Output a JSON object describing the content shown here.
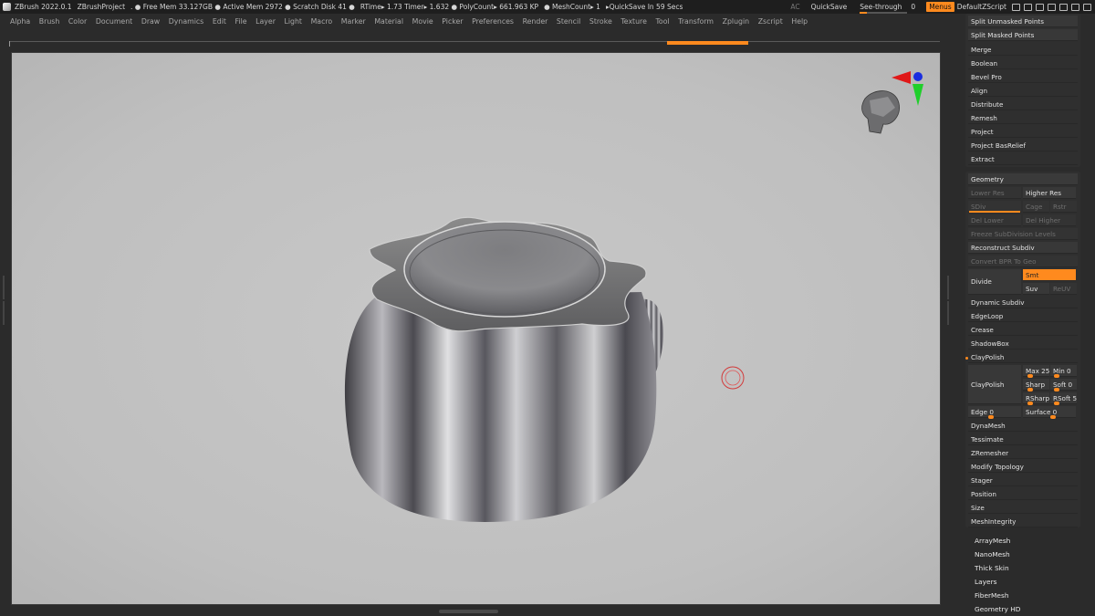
{
  "titlebar": {
    "items": [
      "ZBrush 2022.0.1",
      "ZBrushProject",
      ". ● Free Mem 33.127GB ● Active Mem 2972 ● Scratch Disk 41 ●",
      "RTime▸ 1.73 Timer▸ 1.632 ● PolyCount▸ 661.963 KP",
      "● MeshCount▸ 1",
      "▸QuickSave In 59 Secs"
    ],
    "ac": "AC",
    "quicksave": "QuickSave",
    "see_through_label": "See-through",
    "see_through_value": "0",
    "menus": "Menus",
    "default_zscript": "DefaultZScript"
  },
  "menubar": [
    "Alpha",
    "Brush",
    "Color",
    "Document",
    "Draw",
    "Dynamics",
    "Edit",
    "File",
    "Layer",
    "Light",
    "Macro",
    "Marker",
    "Material",
    "Movie",
    "Picker",
    "Preferences",
    "Render",
    "Stencil",
    "Stroke",
    "Texture",
    "Tool",
    "Transform",
    "Zplugin",
    "Zscript",
    "Help"
  ],
  "top_list": [
    "Split Unmasked Points",
    "Split Masked Points",
    "Merge",
    "Boolean",
    "Bevel Pro",
    "Align",
    "Distribute",
    "Remesh",
    "Project",
    "Project BasRelief",
    "Extract"
  ],
  "geometry": {
    "title": "Geometry",
    "lower_res": "Lower Res",
    "higher_res": "Higher Res",
    "sdiv": "SDiv",
    "cage": "Cage",
    "rstr": "Rstr",
    "del_lower": "Del Lower",
    "del_higher": "Del Higher",
    "freeze": "Freeze SubDivision Levels",
    "reconstruct": "Reconstruct Subdiv",
    "convert_bpr": "Convert BPR To Geo",
    "divide": "Divide",
    "smt": "Smt",
    "suv": "Suv",
    "reuv": "ReUV",
    "dynamic_subdiv": "Dynamic Subdiv",
    "edgeloop": "EdgeLoop",
    "crease": "Crease",
    "shadowbox": "ShadowBox",
    "claypolish_header": "ClayPolish",
    "claypolish": "ClayPolish",
    "max": "Max 25",
    "min": "Min 0",
    "sharp": "Sharp",
    "sharp_val": "0",
    "soft": "Soft 0",
    "rsharp": "RSharp",
    "rsoft": "RSoft 5",
    "edge": "Edge 0",
    "surface": "Surface 0",
    "rest": [
      "DynaMesh",
      "Tessimate",
      "ZRemesher",
      "Modify Topology",
      "Stager",
      "Position",
      "Size",
      "MeshIntegrity"
    ]
  },
  "bottom_list": [
    "ArrayMesh",
    "NanoMesh",
    "Thick Skin",
    "Layers",
    "FiberMesh",
    "Geometry HD"
  ],
  "colors": {
    "accent": "#ff8a1e",
    "viewport": "#c0c0c0",
    "panel": "#2f2f2f"
  },
  "icons": [
    "zbrush-logo-icon",
    "head-navigation-icon",
    "axis-gizmo-icon",
    "brush-cursor-icon"
  ]
}
